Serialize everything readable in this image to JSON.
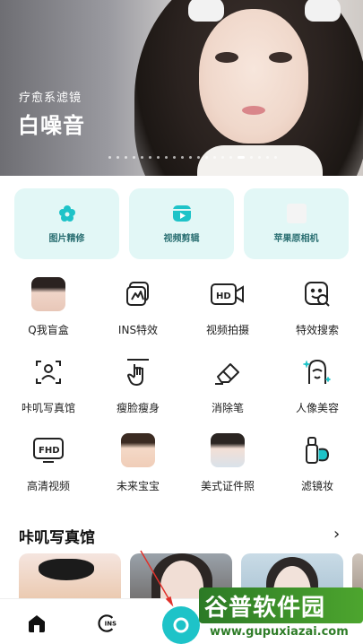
{
  "banner": {
    "subtitle": "疗愈系滤镜",
    "title": "白噪音",
    "dots_count": 21,
    "active_dot": 16
  },
  "feature_cards": [
    {
      "label": "图片精修",
      "icon": "flower-icon"
    },
    {
      "label": "视频剪辑",
      "icon": "video-clip-icon"
    },
    {
      "label": "苹果原相机",
      "icon": "placeholder-square-icon"
    }
  ],
  "tools": [
    {
      "label": "Q我盲盒",
      "icon": "avatar-thumbnail"
    },
    {
      "label": "INS特效",
      "icon": "ins-frame-icon"
    },
    {
      "label": "视频拍摄",
      "icon": "hd-camera-icon"
    },
    {
      "label": "特效搜索",
      "icon": "face-search-icon"
    },
    {
      "label": "咔叽写真馆",
      "icon": "portrait-frame-icon"
    },
    {
      "label": "瘦脸瘦身",
      "icon": "hand-slim-icon"
    },
    {
      "label": "消除笔",
      "icon": "eraser-icon"
    },
    {
      "label": "人像美容",
      "icon": "face-sparkle-icon"
    },
    {
      "label": "高清视频",
      "icon": "fhd-icon"
    },
    {
      "label": "未来宝宝",
      "icon": "baby-thumbnail"
    },
    {
      "label": "美式证件照",
      "icon": "id-photo-thumbnail"
    },
    {
      "label": "滤镜妆",
      "icon": "makeup-bottle-icon"
    }
  ],
  "section": {
    "title": "咔叽写真馆",
    "arrow": "›"
  },
  "bottom_nav": {
    "home_icon": "home-icon",
    "ins_icon": "ins-icon",
    "camera_icon": "camera-icon"
  },
  "watermark": {
    "text": "谷普软件园",
    "url": "www.gupuxiazai.com"
  },
  "colors": {
    "accent": "#1ec3c8",
    "card_bg": "#e2f7f6",
    "card_text": "#2a6f72"
  }
}
